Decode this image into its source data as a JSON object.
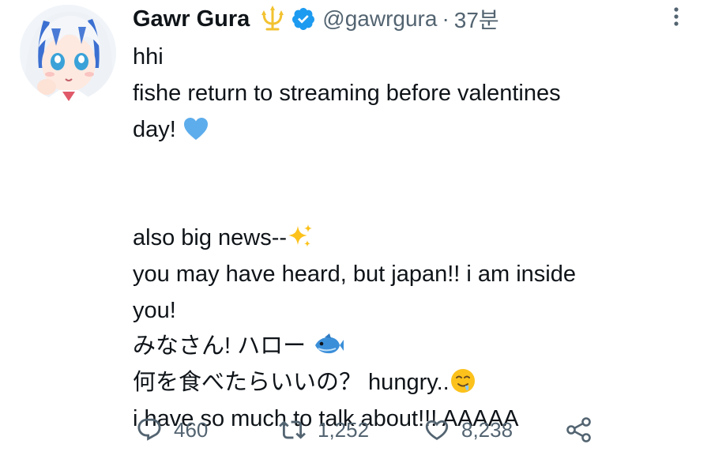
{
  "tweet": {
    "author": {
      "display_name": "Gawr Gura",
      "handle": "@gawrgura",
      "badge_icon": "trident-icon",
      "verified_icon": "verified-icon"
    },
    "separator": "·",
    "timestamp": "37분",
    "lines": [
      "hhi",
      "fishe return to streaming before valentines",
      "day!",
      "",
      "",
      "also big news--",
      "you may have heard, but japan!! i am inside",
      "you!",
      "みなさん! ハロー",
      "何を食べたらいいの？ hungry..",
      "i have so much to talk about!!! AAAAA"
    ],
    "emojis": {
      "heart": "blue-heart-emoji",
      "sparkles": "sparkles-emoji",
      "fish": "fish-emoji",
      "drool": "drooling-face-emoji"
    },
    "actions": {
      "reply": {
        "icon": "reply-icon",
        "count": "460"
      },
      "retweet": {
        "icon": "retweet-icon",
        "count": "1,252"
      },
      "like": {
        "icon": "heart-icon",
        "count": "8,238"
      },
      "share": {
        "icon": "share-icon"
      }
    }
  },
  "colors": {
    "text": "#0f1419",
    "muted": "#536471",
    "verified": "#1d9bf0",
    "trident": "#f2c230"
  }
}
